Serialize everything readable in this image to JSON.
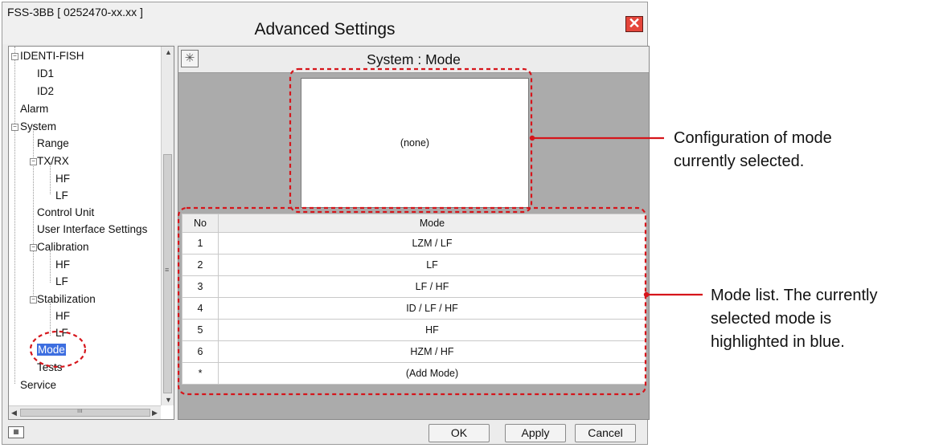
{
  "window": {
    "app_id": "FSS-3BB [ 0252470-xx.xx ]",
    "title": "Advanced Settings",
    "close_glyph": "✕"
  },
  "tree": {
    "identi_fish": "IDENTI-FISH",
    "id1": "ID1",
    "id2": "ID2",
    "alarm": "Alarm",
    "system": "System",
    "range": "Range",
    "txrx": "TX/RX",
    "txrx_hf": "HF",
    "txrx_lf": "LF",
    "control_unit": "Control Unit",
    "ui_settings": "User Interface Settings",
    "calibration": "Calibration",
    "cal_hf": "HF",
    "cal_lf": "LF",
    "stabilization": "Stabilization",
    "stab_hf": "HF",
    "stab_lf": "LF",
    "mode": "Mode",
    "tests": "Tests",
    "service": "Service",
    "expanded_glyph": "−",
    "thumb_grip": "≡",
    "hscroll_grip": "ııı"
  },
  "panel": {
    "title": "System : Mode",
    "config_text": "(none)",
    "table": {
      "headers": [
        "No",
        "Mode"
      ],
      "rows": [
        {
          "no": "1",
          "mode": "LZM / LF"
        },
        {
          "no": "2",
          "mode": "LF"
        },
        {
          "no": "3",
          "mode": "LF / HF"
        },
        {
          "no": "4",
          "mode": "ID / LF / HF"
        },
        {
          "no": "5",
          "mode": "HF"
        },
        {
          "no": "6",
          "mode": "HZM / HF"
        },
        {
          "no": "*",
          "mode": "(Add Mode)"
        }
      ]
    }
  },
  "buttons": {
    "ok": "OK",
    "apply": "Apply",
    "cancel": "Cancel"
  },
  "callouts": {
    "config_line1": "Configuration of mode",
    "config_line2": "currently selected.",
    "list_line1": "Mode list. The currently",
    "list_line2": "selected mode is",
    "list_line3": "highlighted in blue."
  },
  "icons": {
    "panel_icon": "asterisk-grid-icon",
    "keyboard": "keyboard-icon"
  },
  "colors": {
    "selection": "#3d6ee0",
    "close_button": "#e5463b",
    "callout_line": "#d6151b"
  }
}
